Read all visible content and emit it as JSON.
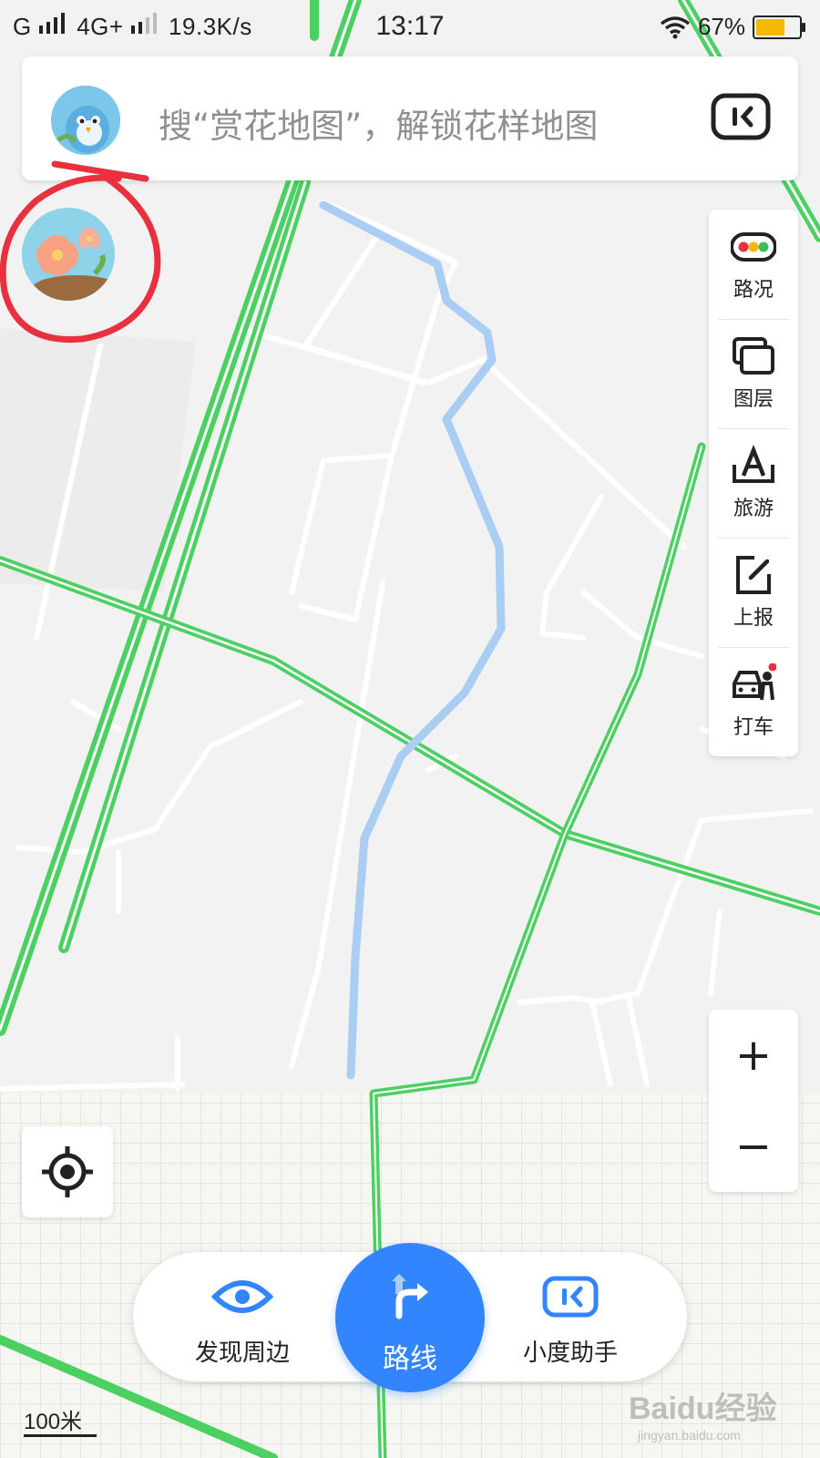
{
  "status_bar": {
    "carrier_left": "G",
    "network": "4G+",
    "speed": "19.3K/s",
    "time": "13:17",
    "battery": "67%",
    "battery_level": 0.67
  },
  "search": {
    "placeholder": "搜“赏花地图”，解锁花样地图",
    "avatar_icon": "bird-mascot-icon",
    "assistant_icon": "xiaodu-assistant-icon"
  },
  "floating_badge": {
    "icon": "flower-map-icon"
  },
  "side_panel": {
    "items": [
      {
        "label": "路况",
        "icon": "traffic-icon"
      },
      {
        "label": "图层",
        "icon": "layers-icon"
      },
      {
        "label": "旅游",
        "icon": "travel-icon"
      },
      {
        "label": "上报",
        "icon": "report-icon"
      },
      {
        "label": "打车",
        "icon": "taxi-icon"
      }
    ]
  },
  "zoom": {
    "in": "+",
    "out": "−"
  },
  "bottom_bar": {
    "discover_label": "发现周边",
    "route_label": "路线",
    "assistant_label": "小度助手"
  },
  "scale": {
    "label": "100米"
  },
  "watermark": {
    "brand": "Baidu经验",
    "url": "jingyan.baidu.com"
  },
  "colors": {
    "road_major": "#4cd062",
    "path": "#a9cdf3",
    "accent": "#3385ff",
    "annotation": "#e8303e"
  }
}
